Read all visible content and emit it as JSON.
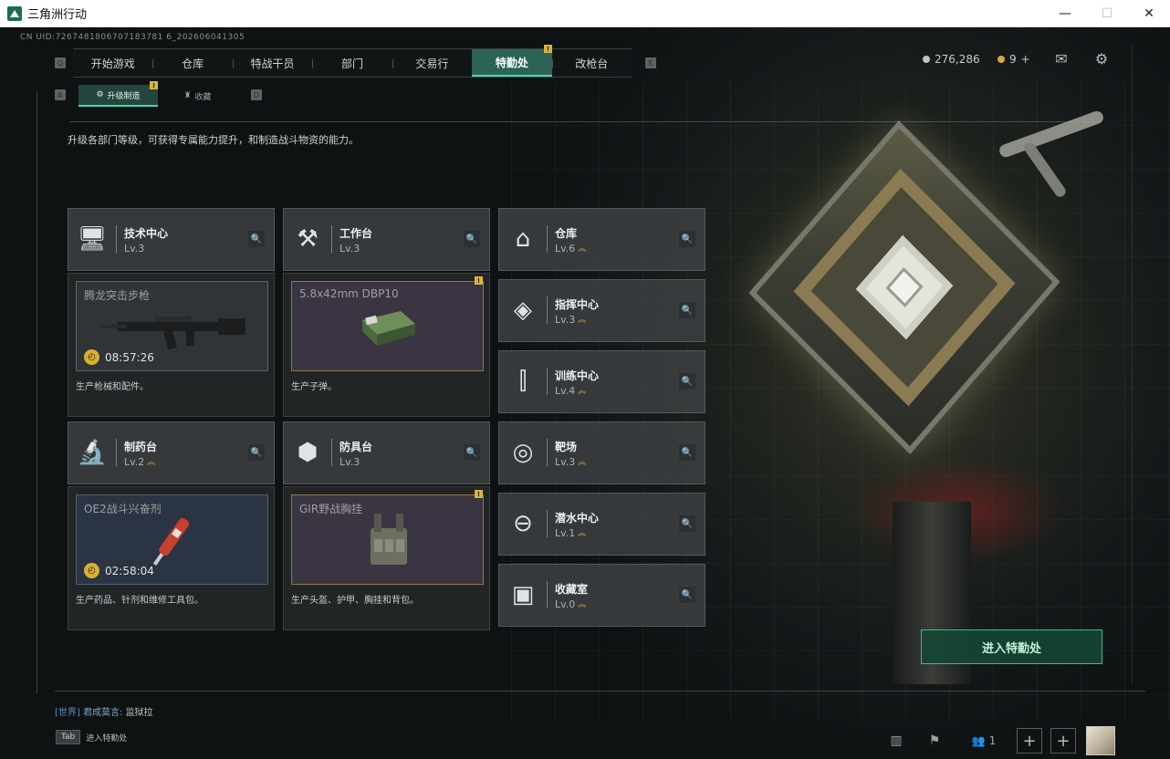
{
  "window": {
    "title": "三角洲行动",
    "minimize": "—",
    "maximize": "☐",
    "close": "✕"
  },
  "uid": "CN UID:7267481806707183781 6_202606041305",
  "nav": {
    "left_key": "Q",
    "right_key": "E",
    "tabs": [
      "开始游戏",
      "仓库",
      "特战干员",
      "部门",
      "交易行",
      "特勤处",
      "改枪台"
    ],
    "active": "特勤处",
    "badge": "!"
  },
  "currency": {
    "coins": "276,286",
    "tickets": "9",
    "add": "+"
  },
  "subnav": {
    "left_key": "A",
    "right_key": "D",
    "tabs": [
      "升级制造",
      "收藏"
    ],
    "active": "升级制造",
    "badge": "!"
  },
  "description": "升级各部门等级，可获得专属能力提升，和制造战斗物资的能力。",
  "workshops": [
    {
      "name": "技术中心",
      "level": "Lv.3",
      "icon": "monitor-icon",
      "product": {
        "item": "腾龙突击步枪",
        "timer": "08:57:26",
        "desc": "生产枪械和配件。",
        "style": "gray"
      }
    },
    {
      "name": "工作台",
      "level": "Lv.3",
      "icon": "tools-icon",
      "product": {
        "item": "5.8x42mm DBP10",
        "timer": "",
        "desc": "生产子弹。",
        "style": "purple",
        "badge": "!"
      }
    },
    {
      "name": "制药台",
      "level": "Lv.2",
      "icon": "microscope-icon",
      "product": {
        "item": "OE2战斗兴奋剂",
        "timer": "02:58:04",
        "desc": "生产药品、针剂和维修工具包。",
        "style": "blue"
      }
    },
    {
      "name": "防具台",
      "level": "Lv.3",
      "icon": "armor-blocks-icon",
      "product": {
        "item": "GIR野战胸挂",
        "timer": "",
        "desc": "生产头盔、护甲、胸挂和背包。",
        "style": "purple",
        "badge": "!"
      }
    }
  ],
  "facilities": [
    {
      "name": "仓库",
      "level": "Lv.6",
      "icon": "warehouse-icon",
      "up": true
    },
    {
      "name": "指挥中心",
      "level": "Lv.3",
      "icon": "command-icon",
      "up": true
    },
    {
      "name": "训练中心",
      "level": "Lv.4",
      "icon": "dumbbell-icon",
      "up": true
    },
    {
      "name": "靶场",
      "level": "Lv.3",
      "icon": "target-icon",
      "up": true
    },
    {
      "name": "潜水中心",
      "level": "Lv.1",
      "icon": "diving-mask-icon",
      "up": true
    },
    {
      "name": "收藏室",
      "level": "Lv.0",
      "icon": "collection-icon",
      "up": true
    }
  ],
  "enter_button": "进入特勤处",
  "chat": {
    "channel": "[世界]",
    "user": "君成莫言:",
    "message": "监狱拉"
  },
  "tab_hint": {
    "key": "Tab",
    "label": "进入特勤处"
  },
  "friends_count": "1",
  "colors": {
    "accent": "#3fdcb0",
    "gold": "#d9b340",
    "enter": "#29c786"
  }
}
